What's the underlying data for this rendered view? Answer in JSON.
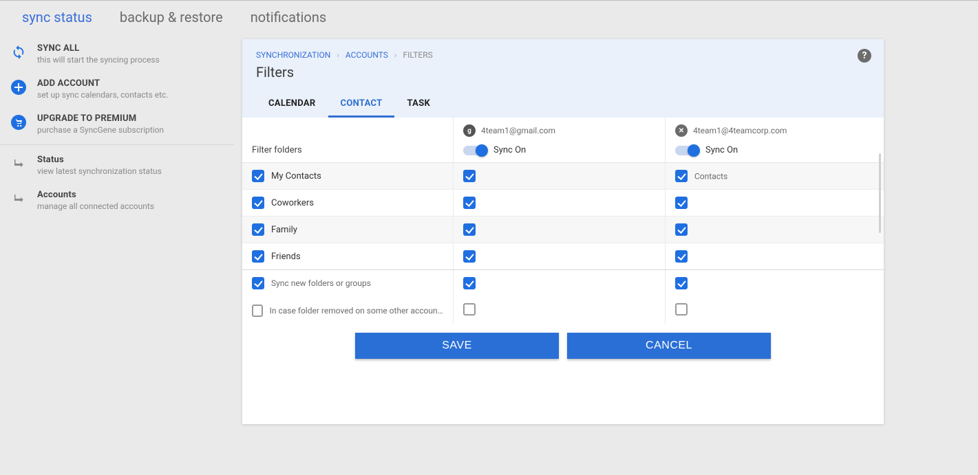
{
  "top_tabs": {
    "sync_status": "sync status",
    "backup_restore": "backup & restore",
    "notifications": "notifications"
  },
  "sidebar": {
    "primary": [
      {
        "title": "SYNC ALL",
        "sub": "this will start the syncing process",
        "icon": "sync"
      },
      {
        "title": "ADD ACCOUNT",
        "sub": "set up sync calendars, contacts etc.",
        "icon": "plus"
      },
      {
        "title": "UPGRADE TO PREMIUM",
        "sub": "purchase a SyncGene subscription",
        "icon": "cart"
      }
    ],
    "secondary": [
      {
        "title": "Status",
        "sub": "view latest synchronization status"
      },
      {
        "title": "Accounts",
        "sub": "manage all connected accounts"
      }
    ]
  },
  "breadcrumb": {
    "lvl1": "SYNCHRONIZATION",
    "lvl2": "ACCOUNTS",
    "lvl3": "FILTERS"
  },
  "panel_title": "Filters",
  "subtabs": {
    "calendar": "CALENDAR",
    "contact": "CONTACT",
    "task": "TASK"
  },
  "filter_folders_label": "Filter folders",
  "accounts": [
    {
      "email": "4team1@gmail.com",
      "sync_label": "Sync On",
      "icon": "g"
    },
    {
      "email": "4team1@4teamcorp.com",
      "sync_label": "Sync On",
      "icon": "x"
    }
  ],
  "folders": [
    {
      "name": "My Contacts",
      "a0": true,
      "a1": true,
      "a1_label": "Contacts"
    },
    {
      "name": "Coworkers",
      "a0": true,
      "a1": true
    },
    {
      "name": "Family",
      "a0": true,
      "a1": true
    },
    {
      "name": "Friends",
      "a0": true,
      "a1": true
    }
  ],
  "options": {
    "sync_new": {
      "label": "Sync new folders or groups",
      "checked": true,
      "a0": true,
      "a1": true
    },
    "delete_removed": {
      "label": "In case folder removed on some other account - delete i...",
      "checked": false,
      "a0": false,
      "a1": false
    }
  },
  "buttons": {
    "save": "SAVE",
    "cancel": "CANCEL"
  }
}
